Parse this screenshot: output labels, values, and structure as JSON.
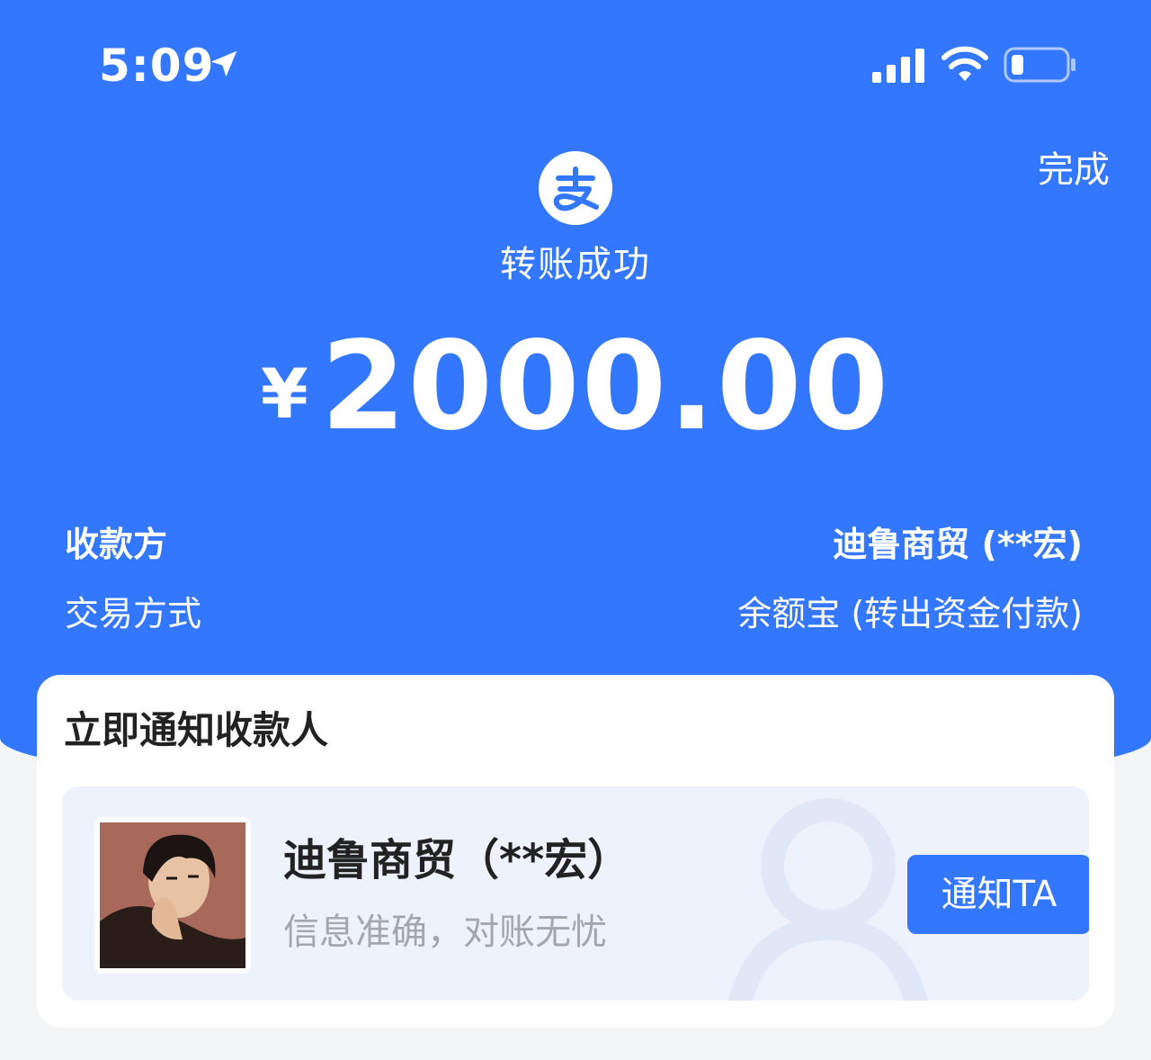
{
  "status_bar": {
    "time": "5:09",
    "icons": [
      "location-arrow-icon",
      "cellular-signal-icon",
      "wifi-icon",
      "battery-icon"
    ]
  },
  "header": {
    "done_label": "完成",
    "logo_icon": "alipay-logo-icon",
    "title": "转账成功"
  },
  "amount": {
    "currency": "¥",
    "value": "2000.00"
  },
  "details": [
    {
      "label": "收款方",
      "value": "迪鲁商贸 (**宏)"
    },
    {
      "label": "交易方式",
      "value": "余额宝 (转出资金付款)"
    }
  ],
  "notify_card": {
    "title": "立即通知收款人",
    "payee_name": "迪鲁商贸（**宏）",
    "payee_subtitle": "信息准确，对账无忧",
    "button_label": "通知TA"
  },
  "colors": {
    "primary_blue": "#3377ff",
    "panel_bg": "#edf2fc",
    "muted_text": "#a3a6ad"
  }
}
